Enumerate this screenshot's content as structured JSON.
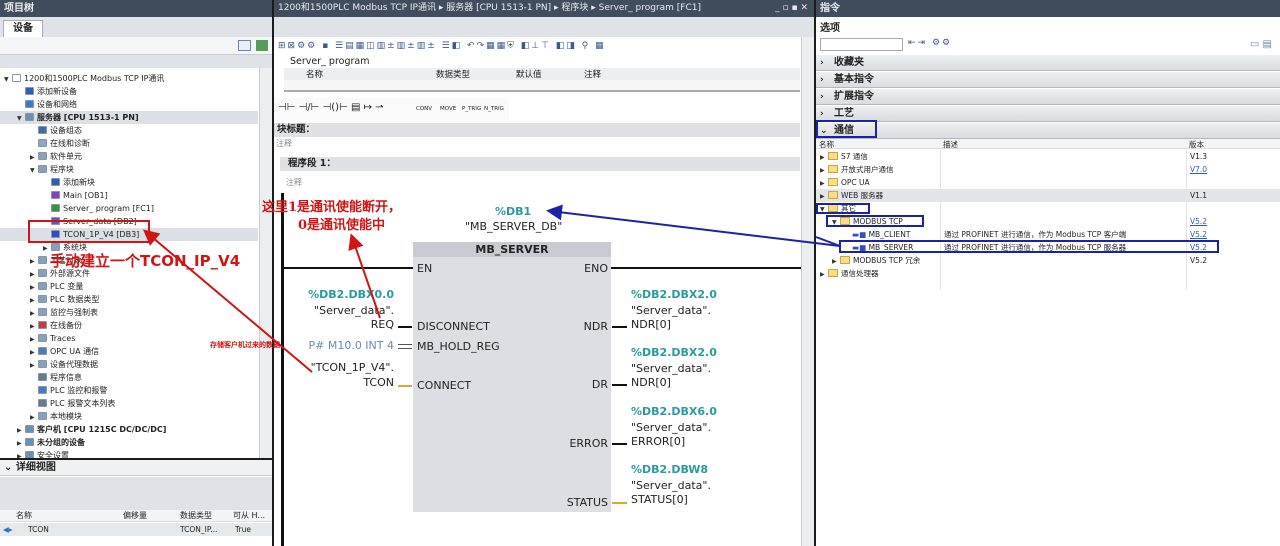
{
  "project_tree": {
    "title": "项目树",
    "tab": "设备",
    "items": [
      {
        "label": "1200和1500PLC Modbus TCP IP通讯",
        "indent": 0,
        "tw": "▼",
        "color": "#ffffff"
      },
      {
        "label": "添加新设备",
        "indent": 1,
        "tw": "",
        "color": "#2f5fb8"
      },
      {
        "label": "设备和网络",
        "indent": 1,
        "tw": "",
        "color": "#3a7bc8"
      },
      {
        "label": "服务器 [CPU 1513-1 PN]",
        "indent": 1,
        "tw": "▼",
        "color": "#6f8fb0",
        "bold": true,
        "sel": true
      },
      {
        "label": "设备组态",
        "indent": 2,
        "tw": "",
        "color": "#3f6ca8"
      },
      {
        "label": "在线和诊断",
        "indent": 2,
        "tw": "",
        "color": "#8fa6c0"
      },
      {
        "label": "软件单元",
        "indent": 2,
        "tw": "▶",
        "color": "#8aa0b8"
      },
      {
        "label": "程序块",
        "indent": 2,
        "tw": "▼",
        "color": "#8aa0b8"
      },
      {
        "label": "添加新块",
        "indent": 3,
        "tw": "",
        "color": "#2f5fb8"
      },
      {
        "label": "Main [OB1]",
        "indent": 3,
        "tw": "",
        "color": "#8a3fc0"
      },
      {
        "label": "Server_ program [FC1]",
        "indent": 3,
        "tw": "",
        "color": "#2e9a3a"
      },
      {
        "label": "Server_data [DB2]",
        "indent": 3,
        "tw": "",
        "color": "#5a5ac0"
      },
      {
        "label": "TCON_1P_V4 [DB3]",
        "indent": 3,
        "tw": "",
        "color": "#2f4fc0",
        "sel": true
      },
      {
        "label": "系统块",
        "indent": 3,
        "tw": "▶",
        "color": "#8aa0b8"
      },
      {
        "label": "工艺对象",
        "indent": 2,
        "tw": "▶",
        "color": "#8aa0b8"
      },
      {
        "label": "外部源文件",
        "indent": 2,
        "tw": "▶",
        "color": "#8aa0b8"
      },
      {
        "label": "PLC 变量",
        "indent": 2,
        "tw": "▶",
        "color": "#8aa0b8"
      },
      {
        "label": "PLC 数据类型",
        "indent": 2,
        "tw": "▶",
        "color": "#8aa0b8"
      },
      {
        "label": "监控与强制表",
        "indent": 2,
        "tw": "▶",
        "color": "#8aa0b8"
      },
      {
        "label": "在线备份",
        "indent": 2,
        "tw": "▶",
        "color": "#c04040"
      },
      {
        "label": "Traces",
        "indent": 2,
        "tw": "▶",
        "color": "#8aa0b8"
      },
      {
        "label": "OPC UA 通信",
        "indent": 2,
        "tw": "▶",
        "color": "#4a7ac0"
      },
      {
        "label": "设备代理数据",
        "indent": 2,
        "tw": "▶",
        "color": "#8aa0b8"
      },
      {
        "label": "程序信息",
        "indent": 2,
        "tw": "",
        "color": "#6a7a8a"
      },
      {
        "label": "PLC 监控和报警",
        "indent": 2,
        "tw": "",
        "color": "#4a7ac0"
      },
      {
        "label": "PLC 报警文本列表",
        "indent": 2,
        "tw": "",
        "color": "#6a7a8a"
      },
      {
        "label": "本地模块",
        "indent": 2,
        "tw": "▶",
        "color": "#8aa0b8"
      },
      {
        "label": "客户机 [CPU 1215C DC/DC/DC]",
        "indent": 1,
        "tw": "▶",
        "color": "#6f8fb0",
        "bold": true
      },
      {
        "label": "未分组的设备",
        "indent": 1,
        "tw": "▶",
        "color": "#6f8fb0",
        "bold": true
      },
      {
        "label": "安全设置",
        "indent": 1,
        "tw": "▶",
        "color": "#6f8fb0"
      }
    ],
    "detail_view": {
      "title": "详细视图",
      "columns": [
        "名称",
        "偏移量",
        "数据类型",
        "可从 H..."
      ],
      "row": [
        "TCON",
        "",
        "TCON_IP...",
        "True"
      ]
    }
  },
  "editor": {
    "breadcrumb": "1200和1500PLC Modbus TCP IP通讯 ▸ 服务器 [CPU 1513-1 PN] ▸ 程序块 ▸ Server_ program [FC1]",
    "block_name": "Server_ program",
    "iface_cols": [
      "名称",
      "数据类型",
      "默认值",
      "注释"
    ],
    "instr": [
      "CONV",
      "MOVE",
      "P_TRIG",
      "N_TRIG"
    ],
    "block_title": "块标题：",
    "comment": "注释",
    "network": "程序段 1：",
    "fb": {
      "instance_addr": "%DB1",
      "instance_name": "\"MB_SERVER_DB\"",
      "name": "MB_SERVER",
      "in": [
        "EN",
        "DISCONNECT",
        "MB_HOLD_REG",
        "CONNECT"
      ],
      "out": [
        "ENO",
        "NDR",
        "DR",
        "ERROR",
        "STATUS"
      ],
      "req_addr": "%DB2.DBX0.0",
      "req_name1": "\"Server_data\".",
      "req_name2": "REQ",
      "hold": "P# M10.0 INT 4",
      "tcon1": "\"TCON_1P_V4\".",
      "tcon2": "TCON",
      "ndr_addr": "%DB2.DBX2.0",
      "ndr_n1": "\"Server_data\".",
      "ndr_n2": "NDR[0]",
      "dr_addr": "%DB2.DBX2.0",
      "dr_n1": "\"Server_data\".",
      "dr_n2": "NDR[0]",
      "err_addr": "%DB2.DBX6.0",
      "err_n1": "\"Server_data\".",
      "err_n2": "ERROR[0]",
      "st_addr": "%DB2.DBW8",
      "st_n1": "\"Server_data\".",
      "st_n2": "STATUS[0]"
    }
  },
  "annotations": {
    "note1a": "这里1是通讯使能断开，",
    "note1b": "0是通讯使能中",
    "note2": "手动建立一个TCON_IP_V4",
    "note3": "存储客户机过来的数据"
  },
  "instructions": {
    "title": "指令",
    "options": "选项",
    "categories": [
      "收藏夹",
      "基本指令",
      "扩展指令",
      "工艺",
      "通信"
    ],
    "cols": [
      "名称",
      "描述",
      "版本"
    ],
    "items": [
      {
        "label": "S7 通信",
        "indent": 0,
        "tw": "▶",
        "folder": true,
        "ver": "V1.3"
      },
      {
        "label": "开放式用户通信",
        "indent": 0,
        "tw": "▶",
        "folder": true,
        "ver": "V7.0",
        "link": true
      },
      {
        "label": "OPC UA",
        "indent": 0,
        "tw": "▶",
        "folder": true,
        "ver": ""
      },
      {
        "label": "WEB 服务器",
        "indent": 0,
        "tw": "▶",
        "folder": true,
        "ver": "V1.1",
        "sel": true
      },
      {
        "label": "其它",
        "indent": 0,
        "tw": "▼",
        "folder": true,
        "ver": ""
      },
      {
        "label": "MODBUS TCP",
        "indent": 1,
        "tw": "▼",
        "folder": true,
        "ver": "V5.2",
        "link": true
      },
      {
        "label": "MB_CLIENT",
        "indent": 2,
        "tw": "",
        "folder": false,
        "desc": "通过 PROFINET 进行通信，作为 Modbus TCP 客户端",
        "ver": "V5.2",
        "link": true
      },
      {
        "label": "MB_SERVER",
        "indent": 2,
        "tw": "",
        "folder": false,
        "desc": "通过 PROFINET 进行通信，作为 Modbus TCP 服务器",
        "ver": "V5.2",
        "link": true
      },
      {
        "label": "MODBUS TCP 冗余",
        "indent": 1,
        "tw": "▶",
        "folder": true,
        "ver": "V5.2"
      },
      {
        "label": "通信处理器",
        "indent": 0,
        "tw": "▶",
        "folder": true,
        "ver": ""
      }
    ]
  }
}
